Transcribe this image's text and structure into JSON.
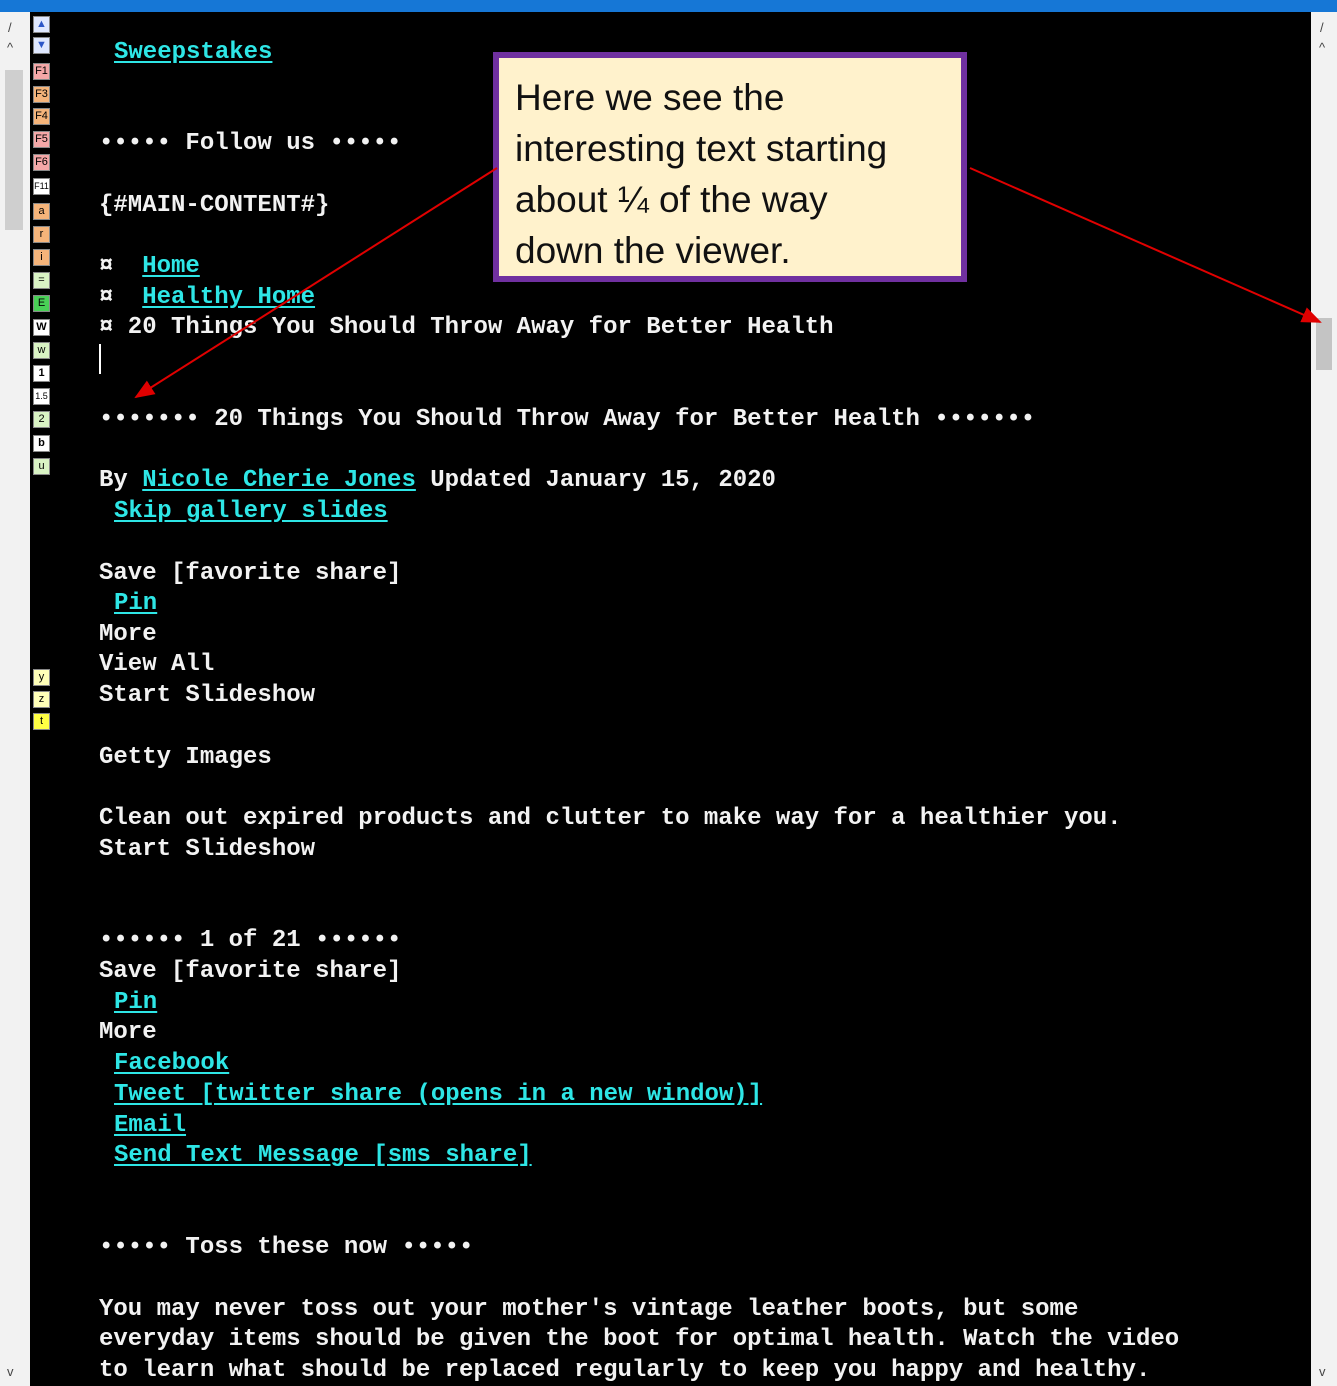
{
  "gutter": {
    "slash": "/",
    "caret_up": "^",
    "caret_down": "v"
  },
  "toolbar": {
    "buttons": [
      "▲",
      "▼",
      "F1",
      "F3",
      "F4",
      "F5",
      "F6",
      "F11",
      "a",
      "r",
      "i",
      "=",
      "E",
      "W",
      "w",
      "1",
      "1.5",
      "2",
      "b",
      "u",
      "y",
      "z",
      "t"
    ]
  },
  "content": {
    "sweepstakes": "Sweepstakes",
    "follow_us": "••••• Follow us •••••",
    "main_content_marker": "{#MAIN-CONTENT#}",
    "breadcrumb": {
      "bullet": "¤ ",
      "home": "Home",
      "healthy_home": "Healthy Home",
      "current": "¤ 20 Things You Should Throw Away for Better Health"
    },
    "heading": "••••••• 20 Things You Should Throw Away for Better Health •••••••",
    "byline_prefix": "By ",
    "author": "Nicole Cherie Jones",
    "byline_suffix": " Updated January 15, 2020",
    "skip_gallery": "Skip gallery slides",
    "save_share": "Save [favorite share]",
    "pin": "Pin",
    "more": "More",
    "view_all": "View All",
    "start_slideshow": "Start Slideshow",
    "getty": "Getty Images",
    "clean_out": "Clean out expired products and clutter to make way for a healthier you.",
    "start_slideshow_2": "Start Slideshow",
    "slide_count": "•••••• 1 of 21 ••••••",
    "save_share_2": "Save [favorite share]",
    "pin_2": "Pin",
    "more_2": "More",
    "facebook": "Facebook",
    "tweet": "Tweet [twitter share (opens in a new window)]",
    "email": "Email",
    "send_text": "Send Text Message [sms share]",
    "toss_heading": "••••• Toss these now •••••",
    "para_line1": "You may never toss out your mother's vintage leather boots, but some",
    "para_line2": "everyday items should be given the boot for optimal health. Watch the video",
    "para_line3": "to learn what should be replaced regularly to keep you happy and healthy."
  },
  "callout": {
    "line1": "Here we see the",
    "line2": "interesting text starting",
    "line3": "about ¼ of the way",
    "line4": "down the viewer."
  },
  "colors": {
    "link": "#2ee6e6",
    "text": "#f2f2f2",
    "background": "#000000",
    "callout_border": "#7030a0",
    "callout_fill": "#fff2cc",
    "arrow": "#e00000"
  }
}
